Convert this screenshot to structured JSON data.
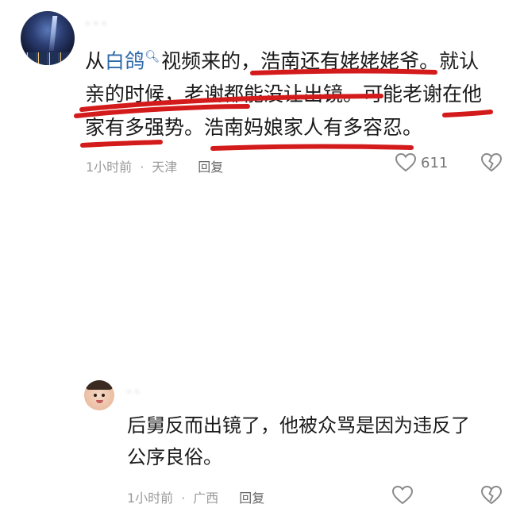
{
  "comments": [
    {
      "username": "· · ·",
      "mention": "白鸽",
      "text_lines": [
        "视频来的，浩南还有姥姥姥爷。就认",
        "亲的时候，老谢都能没让出镜。可能老谢在他",
        "家有多强势。浩南妈娘家人有多容忍。"
      ],
      "prefix": "从",
      "time": "1小时前",
      "location": "天津",
      "reply_label": "回复",
      "like_count": "611"
    },
    {
      "username": "· ·",
      "text_lines": [
        "后舅反而出镜了，他被众骂是因为违反了",
        "公序良俗。"
      ],
      "time": "1小时前",
      "location": "广西",
      "reply_label": "回复",
      "like_count": ""
    }
  ],
  "icons": {
    "mention": "mention-search-icon",
    "like": "heart-icon",
    "dislike": "broken-heart-icon"
  },
  "colors": {
    "mention": "#2f69a8",
    "annotation": "#d41b1b"
  }
}
